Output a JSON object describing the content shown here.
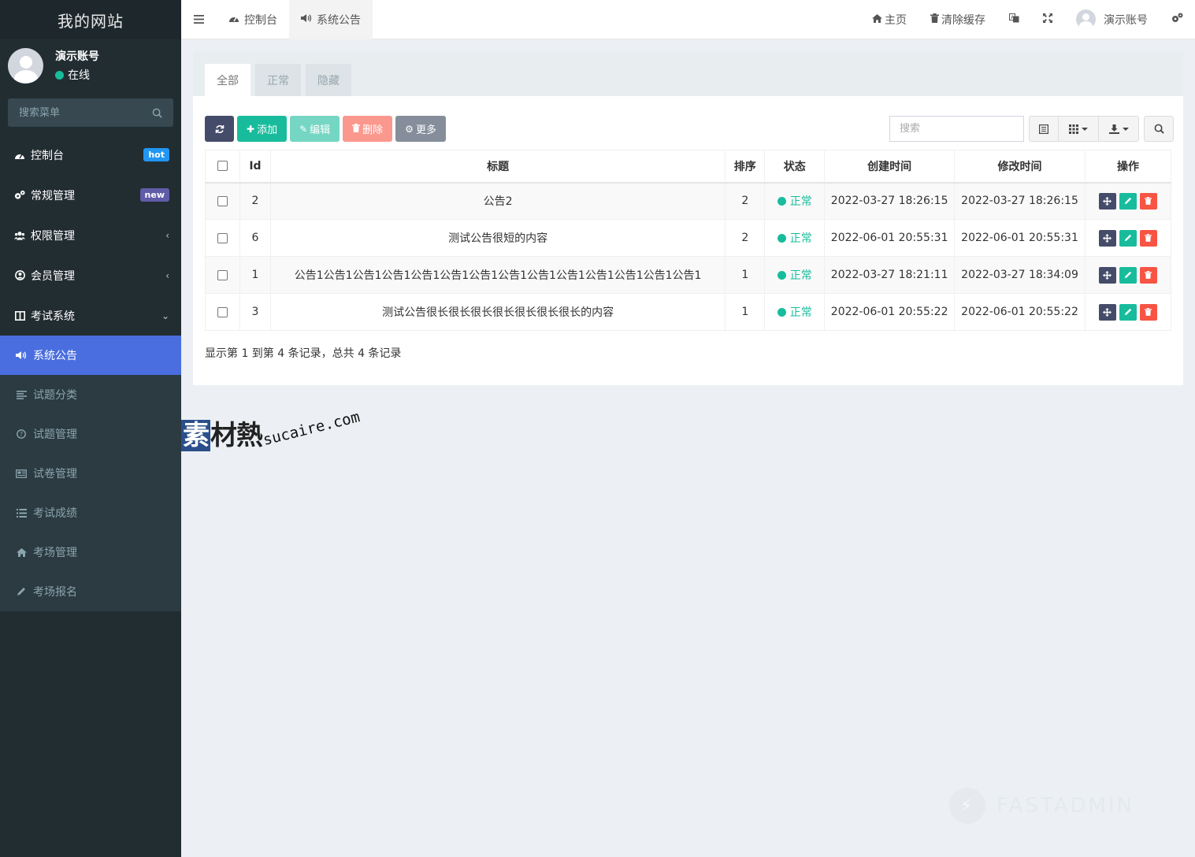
{
  "brand": "我的网站",
  "user": {
    "name": "演示账号",
    "status": "在线"
  },
  "sidebar": {
    "search_placeholder": "搜索菜单",
    "items": [
      {
        "label": "控制台",
        "badge": "hot"
      },
      {
        "label": "常规管理",
        "badge": "new"
      },
      {
        "label": "权限管理"
      },
      {
        "label": "会员管理"
      },
      {
        "label": "考试系统"
      }
    ],
    "submenu": [
      {
        "label": "系统公告"
      },
      {
        "label": "试题分类"
      },
      {
        "label": "试题管理"
      },
      {
        "label": "试卷管理"
      },
      {
        "label": "考试成绩"
      },
      {
        "label": "考场管理"
      },
      {
        "label": "考场报名"
      }
    ]
  },
  "header": {
    "tabs": [
      {
        "label": "控制台"
      },
      {
        "label": "系统公告"
      }
    ],
    "home": "主页",
    "clear_cache": "清除缓存",
    "account": "演示账号"
  },
  "panel": {
    "tabs": [
      {
        "label": "全部"
      },
      {
        "label": "正常"
      },
      {
        "label": "隐藏"
      }
    ],
    "toolbar": {
      "add": "添加",
      "edit": "编辑",
      "delete": "删除",
      "more": "更多"
    },
    "search_placeholder": "搜索",
    "table": {
      "headers": [
        "Id",
        "标题",
        "排序",
        "状态",
        "创建时间",
        "修改时间",
        "操作"
      ],
      "rows": [
        {
          "id": "2",
          "title": "公告2",
          "weigh": "2",
          "status": "正常",
          "created": "2022-03-27 18:26:15",
          "updated": "2022-03-27 18:26:15"
        },
        {
          "id": "6",
          "title": "测试公告很短的内容",
          "weigh": "2",
          "status": "正常",
          "created": "2022-06-01 20:55:31",
          "updated": "2022-06-01 20:55:31"
        },
        {
          "id": "1",
          "title": "公告1公告1公告1公告1公告1公告1公告1公告1公告1公告1公告1公告1公告1公告1",
          "weigh": "1",
          "status": "正常",
          "created": "2022-03-27 18:21:11",
          "updated": "2022-03-27 18:34:09"
        },
        {
          "id": "3",
          "title": "测试公告很长很长很长很长很长很长很长的内容",
          "weigh": "1",
          "status": "正常",
          "created": "2022-06-01 20:55:22",
          "updated": "2022-06-01 20:55:22"
        }
      ]
    },
    "pagination_info": "显示第 1 到第 4 条记录，总共 4 条记录"
  },
  "watermark": {
    "cn": "素材熱",
    "en": "sucaire.com",
    "fastadmin": "FASTADMIN"
  },
  "colors": {
    "sidebar_bg": "#222d32",
    "active_menu": "#4a6ee0",
    "success": "#18bc9c",
    "danger": "#f75444",
    "dark_btn": "#444c69"
  }
}
